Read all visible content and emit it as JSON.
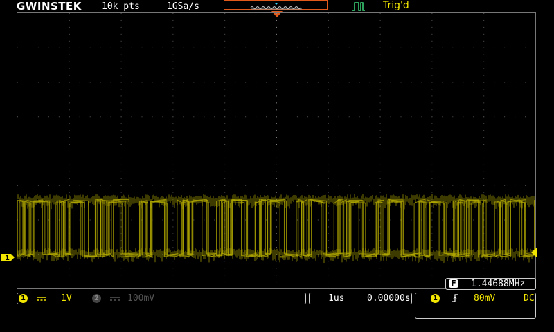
{
  "header": {
    "brand": "GWINSTEK",
    "memory_depth": "10k pts",
    "sample_rate": "1GSa/s",
    "trigger_status": "Trig'd"
  },
  "measurement": {
    "freq_label": "F",
    "frequency": "1.44688MHz"
  },
  "channels": {
    "ch1": {
      "number": "1",
      "coupling_icon": "dc-coupling-icon",
      "scale": "1V",
      "enabled": true
    },
    "ch2": {
      "number": "2",
      "coupling_icon": "dc-coupling-icon",
      "scale": "100mV",
      "enabled": false
    }
  },
  "timebase": {
    "scale": "1us",
    "position": "0.00000s"
  },
  "trigger": {
    "source": "1",
    "slope_icon": "rising-edge-icon",
    "level": "80mV",
    "coupling": "DC"
  },
  "colors": {
    "ch1": "#f2e600",
    "trace": "#b3a900",
    "accent": "#e25a1b",
    "trig_icon": "#3cd67a"
  }
}
